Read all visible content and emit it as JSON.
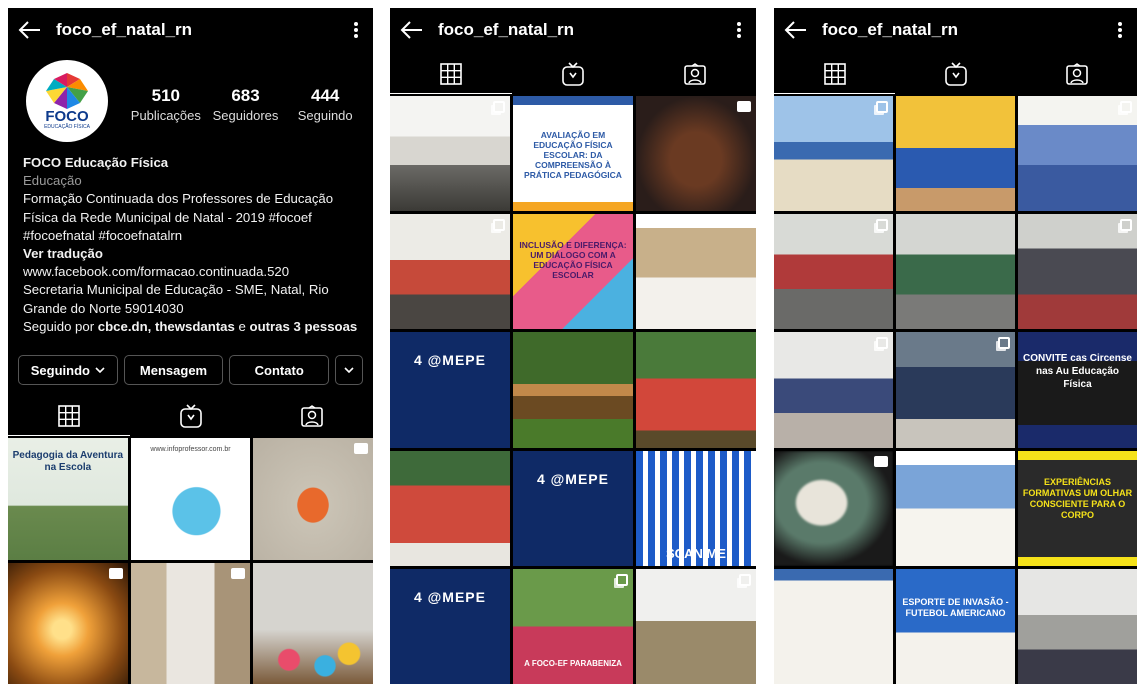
{
  "username": "foco_ef_natal_rn",
  "profile": {
    "logo_text": "FOCO",
    "logo_subtext": "EDUCAÇÃO FÍSICA",
    "stats": [
      {
        "value": "510",
        "label": "Publicações"
      },
      {
        "value": "683",
        "label": "Seguidores"
      },
      {
        "value": "444",
        "label": "Seguindo"
      }
    ],
    "name": "FOCO Educação Física",
    "category": "Educação",
    "bio_lines": [
      "Formação Continuada dos Professores de Educação",
      "Física da Rede Municipal de Natal - 2019 #focoef",
      "#focoefnatal #focoefnatalrn"
    ],
    "see_translation": "Ver tradução",
    "link": "www.facebook.com/formacao.continuada.520",
    "address_lines": [
      "Secretaria Municipal de Educação - SME, Natal, Rio",
      "Grande do Norte 59014030"
    ],
    "followed_by_prefix": "Seguido por ",
    "followed_by_names": "cbce.dn, thewsdantas",
    "followed_by_mid": " e ",
    "followed_by_others": "outras 3 pessoas",
    "buttons": {
      "following": "Seguindo",
      "message": "Mensagem",
      "contact": "Contato"
    }
  },
  "posts": {
    "p1": [
      {
        "caption": "Pedagogia da Aventura na Escola"
      },
      {
        "caption": "www.infoprofessor.com.br"
      },
      {
        "caption": ""
      },
      {
        "caption": ""
      },
      {
        "caption": ""
      },
      {
        "caption": ""
      }
    ],
    "p2": [
      {
        "caption": ""
      },
      {
        "caption": "AVALIAÇÃO EM EDUCAÇÃO FÍSICA ESCOLAR: DA COMPREENSÃO À PRÁTICA PEDAGÓGICA"
      },
      {
        "caption": ""
      },
      {
        "caption": ""
      },
      {
        "caption": "INCLUSÃO E DIFERENÇA: UM DIÁLOGO COM A EDUCAÇÃO FÍSICA ESCOLAR"
      },
      {
        "caption": ""
      },
      {
        "caption": "4 @MEPE"
      },
      {
        "caption": ""
      },
      {
        "caption": ""
      },
      {
        "caption": ""
      },
      {
        "caption": "4 @MEPE"
      },
      {
        "caption": "SCAN ME"
      },
      {
        "caption": "4 @MEPE"
      },
      {
        "caption": "A FOCO-EF PARABENIZA"
      },
      {
        "caption": ""
      }
    ],
    "p3": [
      {
        "caption": ""
      },
      {
        "caption": ""
      },
      {
        "caption": ""
      },
      {
        "caption": ""
      },
      {
        "caption": ""
      },
      {
        "caption": ""
      },
      {
        "caption": ""
      },
      {
        "caption": ""
      },
      {
        "caption": "CONVITE cas Circense nas Au Educação Física"
      },
      {
        "caption": ""
      },
      {
        "caption": ""
      },
      {
        "caption": "EXPERIÊNCIAS FORMATIVAS UM OLHAR CONSCIENTE PARA O CORPO"
      },
      {
        "caption": ""
      },
      {
        "caption": "ESPORTE DE INVASÃO - FUTEBOL AMERICANO"
      },
      {
        "caption": ""
      }
    ]
  },
  "colors": {
    "background": "#000000",
    "text": "#ffffff",
    "muted": "#9a9a9a",
    "button_border": "#555555"
  }
}
